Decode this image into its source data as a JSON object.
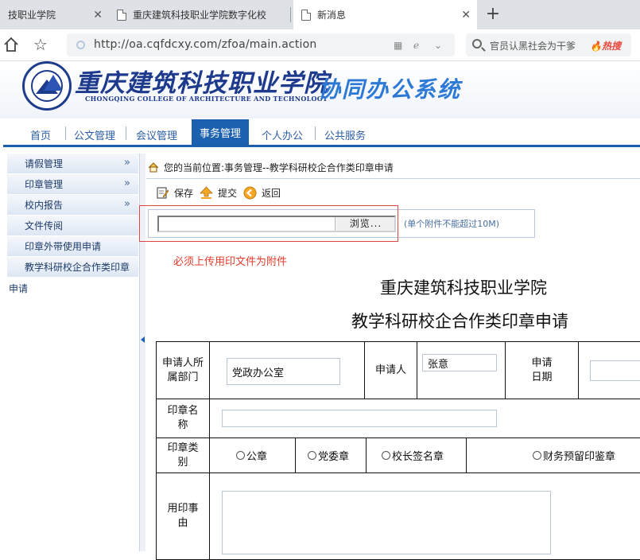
{
  "browser": {
    "tabs": [
      {
        "label": "技职业学院",
        "active": false
      },
      {
        "label": "重庆建筑科技职业学院数字化校",
        "active": false
      },
      {
        "label": "新消息",
        "active": true
      }
    ],
    "url": "http://oa.cqfdcxy.com/zfoa/main.action",
    "search_text": "官员认黑社会为干爹",
    "search_badge": "热搜"
  },
  "header": {
    "logo_cn": "重庆建筑科技职业学院",
    "logo_en": "CHONGQING COLLEGE OF ARCHITECTURE AND TECHNOLOGY",
    "system_title": "协同办公系统"
  },
  "nav": {
    "items": [
      {
        "label": "首页",
        "active": false
      },
      {
        "label": "公文管理",
        "active": false
      },
      {
        "label": "会议管理",
        "active": false
      },
      {
        "label": "事务管理",
        "active": true
      },
      {
        "label": "个人办公",
        "active": false
      },
      {
        "label": "公共服务",
        "active": false
      }
    ]
  },
  "sidebar": {
    "items": [
      {
        "label": "请假管理",
        "arrow": "»"
      },
      {
        "label": "印章管理",
        "arrow": "»"
      },
      {
        "label": "校内报告",
        "arrow": "»"
      },
      {
        "label": "文件传阅",
        "arrow": ""
      },
      {
        "label": "印章外带使用申请",
        "arrow": ""
      },
      {
        "label": "教学科研校企合作类印章",
        "arrow": ""
      }
    ],
    "overflow_text": "申请"
  },
  "content": {
    "breadcrumb": "您的当前位置:事务管理--教学科研校企合作类印章申请",
    "toolbar": {
      "save": "保存",
      "submit": "提交",
      "back": "返回"
    },
    "upload": {
      "browse_label": "浏览...",
      "hint": "(单个附件不能超过10M)"
    },
    "warning": "必须上传用印文件为附件",
    "form_title_1": "重庆建筑科技职业学院",
    "form_title_2": "教学科研校企合作类印章申请"
  },
  "form": {
    "dept_label": "申请人所属部门",
    "dept_value": "党政办公室",
    "applicant_label": "申请人",
    "applicant_value": "张意",
    "date_label": "申请日期",
    "date_value": "",
    "seal_name_label": "印章名称",
    "seal_name_value": "",
    "seal_type_label": "印章类别",
    "seal_types": [
      "公章",
      "党委章",
      "校长签名章",
      "财务预留印鉴章"
    ],
    "reason_label": "用印事由",
    "reason_value": ""
  }
}
